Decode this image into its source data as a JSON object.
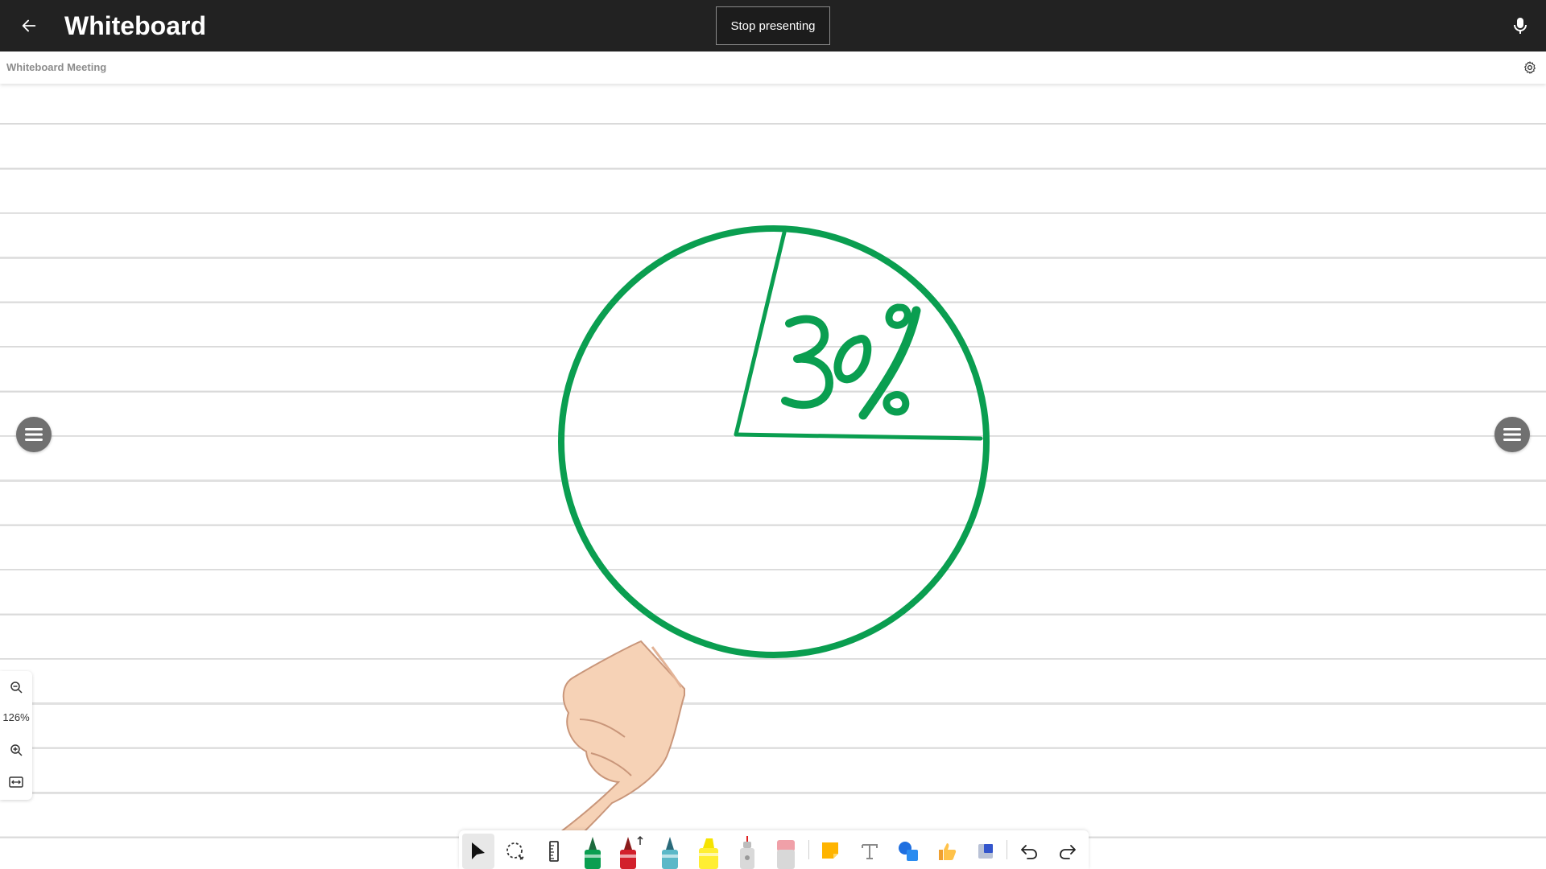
{
  "app": {
    "title": "Whiteboard",
    "stop_label": "Stop presenting",
    "meeting_name": "Whiteboard Meeting"
  },
  "drawing": {
    "text": "30%",
    "ink_color": "#0a9e50"
  },
  "zoom": {
    "level": "126%"
  },
  "toolbar": {
    "tools": [
      "select",
      "lasso",
      "ruler",
      "pen-green",
      "pen-red",
      "pen-blue",
      "highlighter",
      "laser-pointer",
      "eraser",
      "sticky-note",
      "text",
      "shapes",
      "reactions",
      "templates",
      "undo",
      "redo"
    ]
  },
  "colors": {
    "topbar_bg": "#222222",
    "ink_green": "#0a9e50",
    "side_menu": "#707070"
  }
}
